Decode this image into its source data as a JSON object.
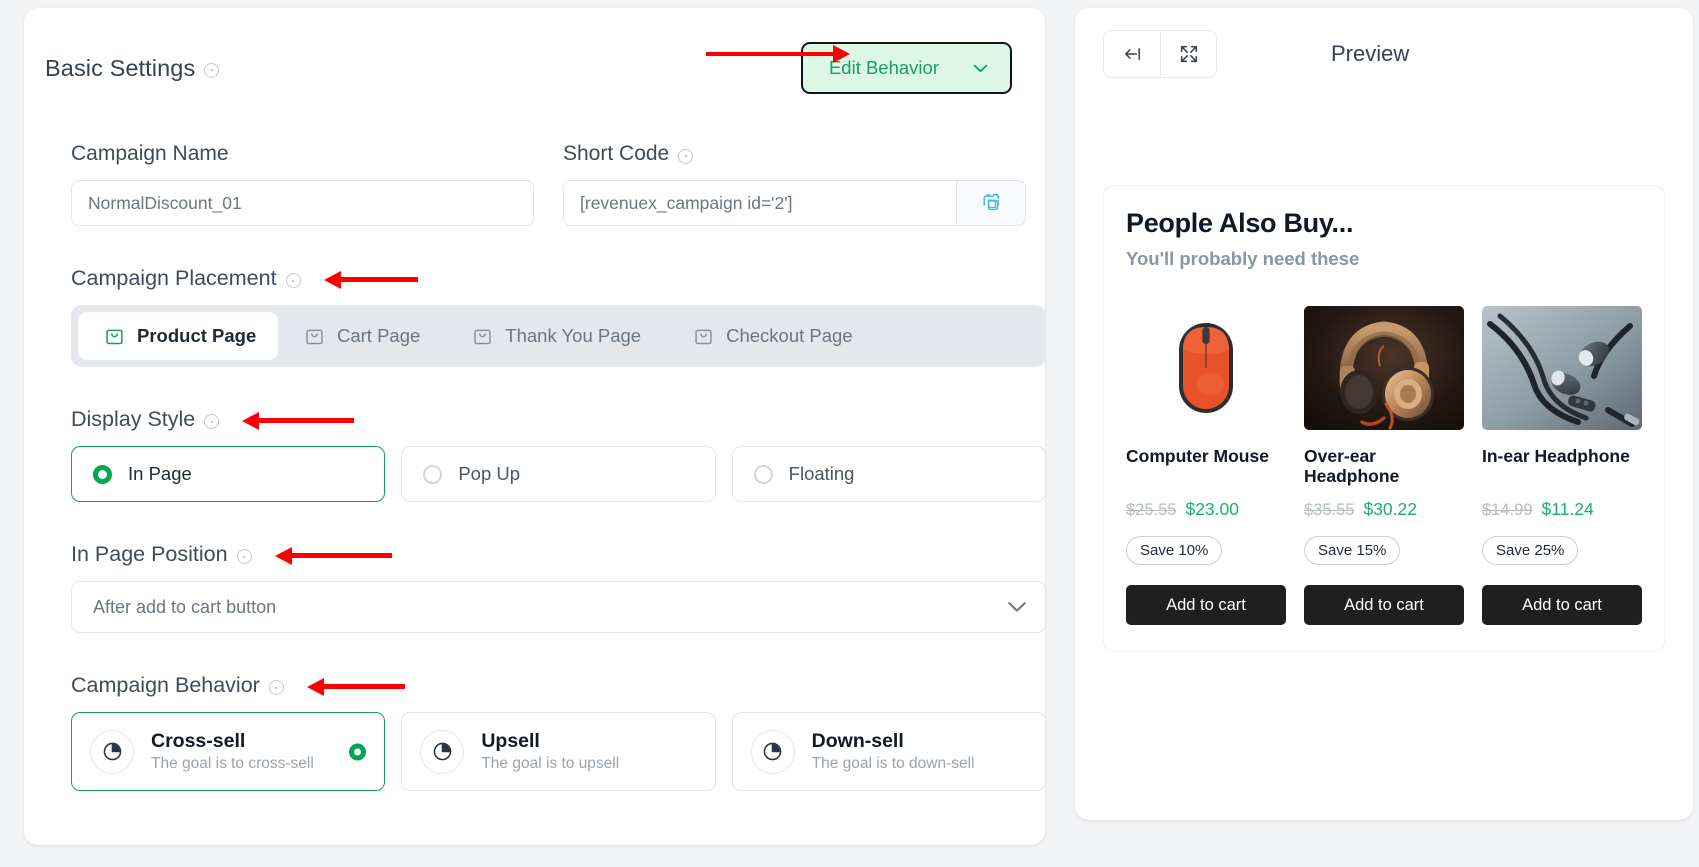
{
  "settings": {
    "section_title": "Basic Settings",
    "edit_behavior_label": "Edit Behavior",
    "campaign_name": {
      "label": "Campaign Name",
      "value": "NormalDiscount_01"
    },
    "short_code": {
      "label": "Short Code",
      "value": "[revenuex_campaign id='2']"
    },
    "placement": {
      "label": "Campaign Placement",
      "tabs": [
        {
          "label": "Product Page",
          "icon": "shopping-bag-icon",
          "active": true
        },
        {
          "label": "Cart Page",
          "icon": "shopping-bag-icon",
          "active": false
        },
        {
          "label": "Thank You Page",
          "icon": "shopping-bag-icon",
          "active": false
        },
        {
          "label": "Checkout Page",
          "icon": "shopping-bag-icon",
          "active": false
        }
      ]
    },
    "display_style": {
      "label": "Display Style",
      "options": [
        {
          "label": "In Page",
          "selected": true
        },
        {
          "label": "Pop Up",
          "selected": false
        },
        {
          "label": "Floating",
          "selected": false
        }
      ]
    },
    "in_page_position": {
      "label": "In Page Position",
      "value": "After add to cart button"
    },
    "campaign_behavior": {
      "label": "Campaign Behavior",
      "options": [
        {
          "title": "Cross-sell",
          "subtitle": "The goal is to cross-sell",
          "selected": true
        },
        {
          "title": "Upsell",
          "subtitle": "The goal is to upsell",
          "selected": false
        },
        {
          "title": "Down-sell",
          "subtitle": "The goal is to down-sell",
          "selected": false
        }
      ]
    }
  },
  "preview": {
    "title": "Preview",
    "collapse_icon": "collapse-left-icon",
    "expand_icon": "expand-fullscreen-icon",
    "offer": {
      "heading": "People Also Buy...",
      "subheading": "You'll probably need these",
      "products": [
        {
          "name": "Computer Mouse",
          "image": "computer-mouse-image",
          "old_price": "$25.55",
          "new_price": "$23.00",
          "save_label": "Save 10%",
          "cta": "Add to cart"
        },
        {
          "name": "Over-ear Headphone",
          "image": "over-ear-headphone-image",
          "old_price": "$35.55",
          "new_price": "$30.22",
          "save_label": "Save 15%",
          "cta": "Add to cart"
        },
        {
          "name": "In-ear Headphone",
          "image": "in-ear-headphone-image",
          "old_price": "$14.99",
          "new_price": "$11.24",
          "save_label": "Save 25%",
          "cta": "Add to cart"
        }
      ]
    }
  },
  "colors": {
    "accent_green": "#00a651",
    "price_green": "#16b364",
    "button_dark": "#1f1f1f",
    "annotation_red": "#ff0000"
  }
}
